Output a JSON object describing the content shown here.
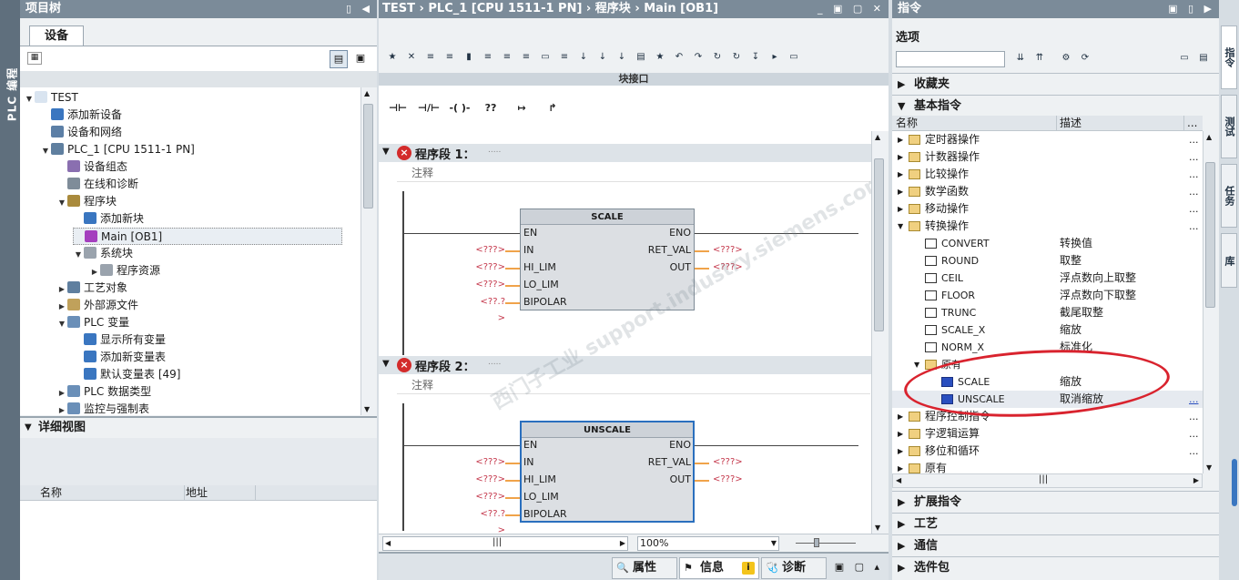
{
  "left_vtab": "PLC 编程",
  "project_tree": {
    "title": "项目树",
    "tab": "设备",
    "items": [
      {
        "label": "TEST",
        "level": 0,
        "expand": "open"
      },
      {
        "label": "添加新设备",
        "level": 1,
        "expand": ""
      },
      {
        "label": "设备和网络",
        "level": 1,
        "expand": ""
      },
      {
        "label": "PLC_1 [CPU 1511-1 PN]",
        "level": 1,
        "expand": "open"
      },
      {
        "label": "设备组态",
        "level": 2,
        "expand": ""
      },
      {
        "label": "在线和诊断",
        "level": 2,
        "expand": ""
      },
      {
        "label": "程序块",
        "level": 2,
        "expand": "open"
      },
      {
        "label": "添加新块",
        "level": 3,
        "expand": ""
      },
      {
        "label": "Main [OB1]",
        "level": 3,
        "expand": "",
        "selected": true
      },
      {
        "label": "系统块",
        "level": 3,
        "expand": "open"
      },
      {
        "label": "程序资源",
        "level": 4,
        "expand": "closed"
      },
      {
        "label": "工艺对象",
        "level": 2,
        "expand": "closed"
      },
      {
        "label": "外部源文件",
        "level": 2,
        "expand": "closed"
      },
      {
        "label": "PLC 变量",
        "level": 2,
        "expand": "open"
      },
      {
        "label": "显示所有变量",
        "level": 3,
        "expand": ""
      },
      {
        "label": "添加新变量表",
        "level": 3,
        "expand": ""
      },
      {
        "label": "默认变量表 [49]",
        "level": 3,
        "expand": ""
      },
      {
        "label": "PLC 数据类型",
        "level": 2,
        "expand": "closed"
      },
      {
        "label": "监控与强制表",
        "level": 2,
        "expand": "closed"
      }
    ]
  },
  "detail_view": {
    "title": "详细视图",
    "col_name": "名称",
    "col_address": "地址"
  },
  "editor": {
    "breadcrumb": "TEST  ›  PLC_1 [CPU 1511-1 PN]  ›  程序块  ›  Main [OB1]",
    "block_interface": "块接口",
    "ladder_buttons": [
      "⊣⊢",
      "⊣/⊢",
      "-( )-",
      "??",
      "↦",
      "↱"
    ],
    "networks": [
      {
        "title": "程序段 1：",
        "dots": ".....",
        "comment": "注释",
        "block_name": "SCALE",
        "left_pins": [
          "EN",
          "IN",
          "HI_LIM",
          "LO_LIM",
          "BIPOLAR"
        ],
        "left_labels": [
          "",
          "<???>",
          "<???>",
          "<???>",
          "<??.?>"
        ],
        "right_pins": [
          "ENO",
          "RET_VAL",
          "OUT"
        ],
        "right_labels": [
          "",
          "<???>",
          "<???>"
        ]
      },
      {
        "title": "程序段 2：",
        "dots": ".....",
        "comment": "注释",
        "block_name": "UNSCALE",
        "left_pins": [
          "EN",
          "IN",
          "HI_LIM",
          "LO_LIM",
          "BIPOLAR"
        ],
        "left_labels": [
          "",
          "<???>",
          "<???>",
          "<???>",
          "<??.?>"
        ],
        "right_pins": [
          "ENO",
          "RET_VAL",
          "OUT"
        ],
        "right_labels": [
          "",
          "<???>",
          "<???>"
        ]
      }
    ],
    "zoom": "100%",
    "watermark": "西门子工业  support.industry.siemens.com/cs"
  },
  "inspector_tabs": {
    "properties": "属性",
    "info": "信息",
    "diagnostics": "诊断"
  },
  "instructions": {
    "title": "指令",
    "options": "选项",
    "favorites": "收藏夹",
    "basic": "基本指令",
    "col_name": "名称",
    "col_desc": "描述",
    "col_more": "...",
    "rows": [
      {
        "name": "定时器操作",
        "desc": "",
        "more": "...",
        "level": 0,
        "expand": "closed"
      },
      {
        "name": "计数器操作",
        "desc": "",
        "more": "...",
        "level": 0,
        "expand": "closed"
      },
      {
        "name": "比较操作",
        "desc": "",
        "more": "...",
        "level": 0,
        "expand": "closed"
      },
      {
        "name": "数学函数",
        "desc": "",
        "more": "...",
        "level": 0,
        "expand": "closed"
      },
      {
        "name": "移动操作",
        "desc": "",
        "more": "...",
        "level": 0,
        "expand": "closed"
      },
      {
        "name": "转换操作",
        "desc": "",
        "more": "...",
        "level": 0,
        "expand": "open"
      },
      {
        "name": "CONVERT",
        "desc": "转换值",
        "more": "",
        "level": 1,
        "expand": ""
      },
      {
        "name": "ROUND",
        "desc": "取整",
        "more": "",
        "level": 1,
        "expand": ""
      },
      {
        "name": "CEIL",
        "desc": "浮点数向上取整",
        "more": "",
        "level": 1,
        "expand": ""
      },
      {
        "name": "FLOOR",
        "desc": "浮点数向下取整",
        "more": "",
        "level": 1,
        "expand": ""
      },
      {
        "name": "TRUNC",
        "desc": "截尾取整",
        "more": "",
        "level": 1,
        "expand": ""
      },
      {
        "name": "SCALE_X",
        "desc": "缩放",
        "more": "",
        "level": 1,
        "expand": ""
      },
      {
        "name": "NORM_X",
        "desc": "标准化",
        "more": "",
        "level": 1,
        "expand": ""
      },
      {
        "name": "原有",
        "desc": "",
        "more": "",
        "level": 1,
        "expand": "open",
        "folder": true
      },
      {
        "name": "SCALE",
        "desc": "缩放",
        "more": "",
        "level": 2,
        "expand": ""
      },
      {
        "name": "UNSCALE",
        "desc": "取消缩放",
        "more": "...",
        "level": 2,
        "expand": "",
        "highlight": true
      },
      {
        "name": "程序控制指令",
        "desc": "",
        "more": "...",
        "level": 0,
        "expand": "closed"
      },
      {
        "name": "字逻辑运算",
        "desc": "",
        "more": "...",
        "level": 0,
        "expand": "closed"
      },
      {
        "name": "移位和循环",
        "desc": "",
        "more": "...",
        "level": 0,
        "expand": "closed"
      },
      {
        "name": "原有",
        "desc": "",
        "more": "",
        "level": 0,
        "expand": "closed"
      }
    ],
    "extended": "扩展指令",
    "technology": "工艺",
    "communication": "通信",
    "optional": "选件包"
  },
  "right_tabs": [
    "指令",
    "测试",
    "任务",
    "库"
  ],
  "colors": {
    "header": "#7b8b99",
    "callout": "#d9232e",
    "pin_label": "#c4364a",
    "wire_orange": "#f0a34a"
  }
}
